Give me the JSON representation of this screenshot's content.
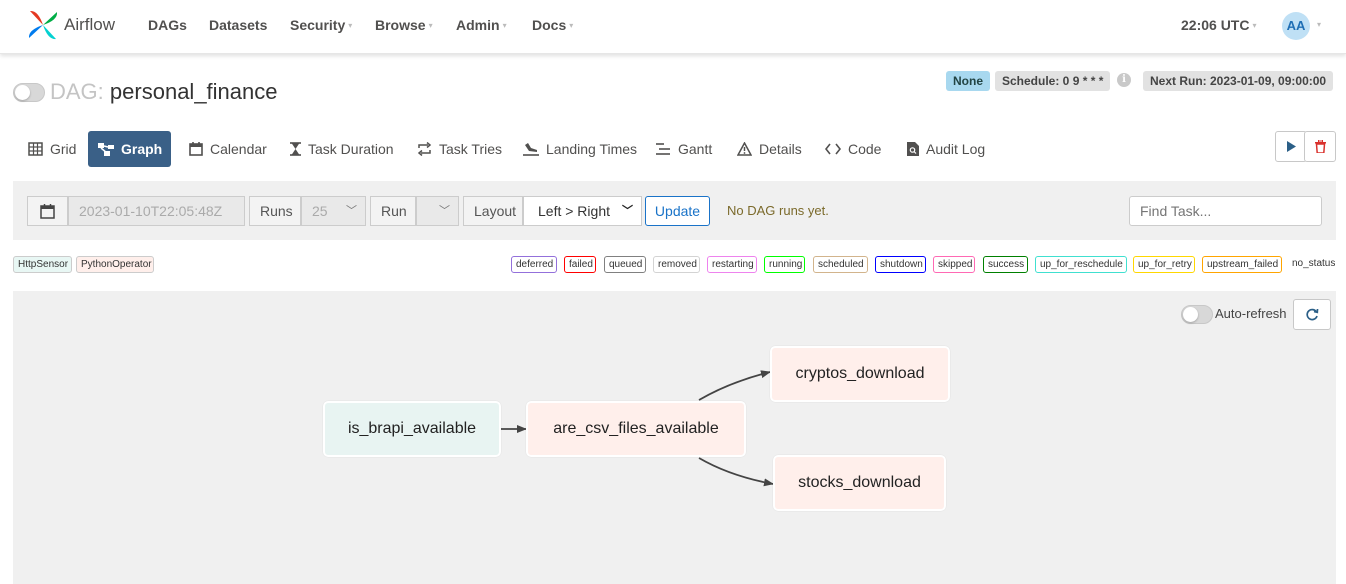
{
  "navbar": {
    "brand": "Airflow",
    "items": [
      {
        "label": "DAGs",
        "dropdown": false
      },
      {
        "label": "Datasets",
        "dropdown": false
      },
      {
        "label": "Security",
        "dropdown": true
      },
      {
        "label": "Browse",
        "dropdown": true
      },
      {
        "label": "Admin",
        "dropdown": true
      },
      {
        "label": "Docs",
        "dropdown": true
      }
    ],
    "time": "22:06 UTC",
    "avatar": "AA"
  },
  "dag": {
    "label": "DAG:",
    "name": "personal_finance",
    "status_badge": "None",
    "schedule": "Schedule: 0 9 * * *",
    "next_run": "Next Run: 2023-01-09, 09:00:00"
  },
  "tabs": [
    {
      "label": "Grid",
      "icon": "grid-icon"
    },
    {
      "label": "Graph",
      "icon": "graph-icon"
    },
    {
      "label": "Calendar",
      "icon": "calendar-icon"
    },
    {
      "label": "Task Duration",
      "icon": "hourglass-icon"
    },
    {
      "label": "Task Tries",
      "icon": "retry-icon"
    },
    {
      "label": "Landing Times",
      "icon": "landing-icon"
    },
    {
      "label": "Gantt",
      "icon": "gantt-icon"
    },
    {
      "label": "Details",
      "icon": "warning-triangle-icon"
    },
    {
      "label": "Code",
      "icon": "code-icon"
    },
    {
      "label": "Audit Log",
      "icon": "audit-log-icon"
    }
  ],
  "filters": {
    "date_value": "2023-01-10T22:05:48Z",
    "runs_label": "Runs",
    "runs_value": "25",
    "run_label": "Run",
    "run_value": "",
    "layout_label": "Layout",
    "layout_value": "Left > Right",
    "update_label": "Update",
    "no_runs_text": "No DAG runs yet.",
    "find_task_placeholder": "Find Task..."
  },
  "operators": [
    {
      "label": "HttpSensor",
      "color": "#e8f7f4"
    },
    {
      "label": "PythonOperator",
      "color": "#ffefeb"
    }
  ],
  "states": [
    {
      "label": "deferred",
      "color": "#9370db"
    },
    {
      "label": "failed",
      "color": "#ff0000"
    },
    {
      "label": "queued",
      "color": "#808080"
    },
    {
      "label": "removed",
      "color": "#d3d3d3"
    },
    {
      "label": "restarting",
      "color": "#ee82ee"
    },
    {
      "label": "running",
      "color": "#00ff00"
    },
    {
      "label": "scheduled",
      "color": "#d2b48c"
    },
    {
      "label": "shutdown",
      "color": "#0000ff"
    },
    {
      "label": "skipped",
      "color": "#ff69b4"
    },
    {
      "label": "success",
      "color": "#008000"
    },
    {
      "label": "up_for_reschedule",
      "color": "#40e0d0"
    },
    {
      "label": "up_for_retry",
      "color": "#ffd700"
    },
    {
      "label": "upstream_failed",
      "color": "#ffa500"
    },
    {
      "label": "no_status",
      "color": "#ffffff"
    }
  ],
  "graph": {
    "auto_refresh_label": "Auto-refresh",
    "nodes": [
      {
        "id": "is_brapi_available",
        "operator": "HttpSensor"
      },
      {
        "id": "are_csv_files_available",
        "operator": "PythonOperator"
      },
      {
        "id": "cryptos_download",
        "operator": "PythonOperator"
      },
      {
        "id": "stocks_download",
        "operator": "PythonOperator"
      }
    ],
    "edges": [
      [
        "is_brapi_available",
        "are_csv_files_available"
      ],
      [
        "are_csv_files_available",
        "cryptos_download"
      ],
      [
        "are_csv_files_available",
        "stocks_download"
      ]
    ]
  }
}
